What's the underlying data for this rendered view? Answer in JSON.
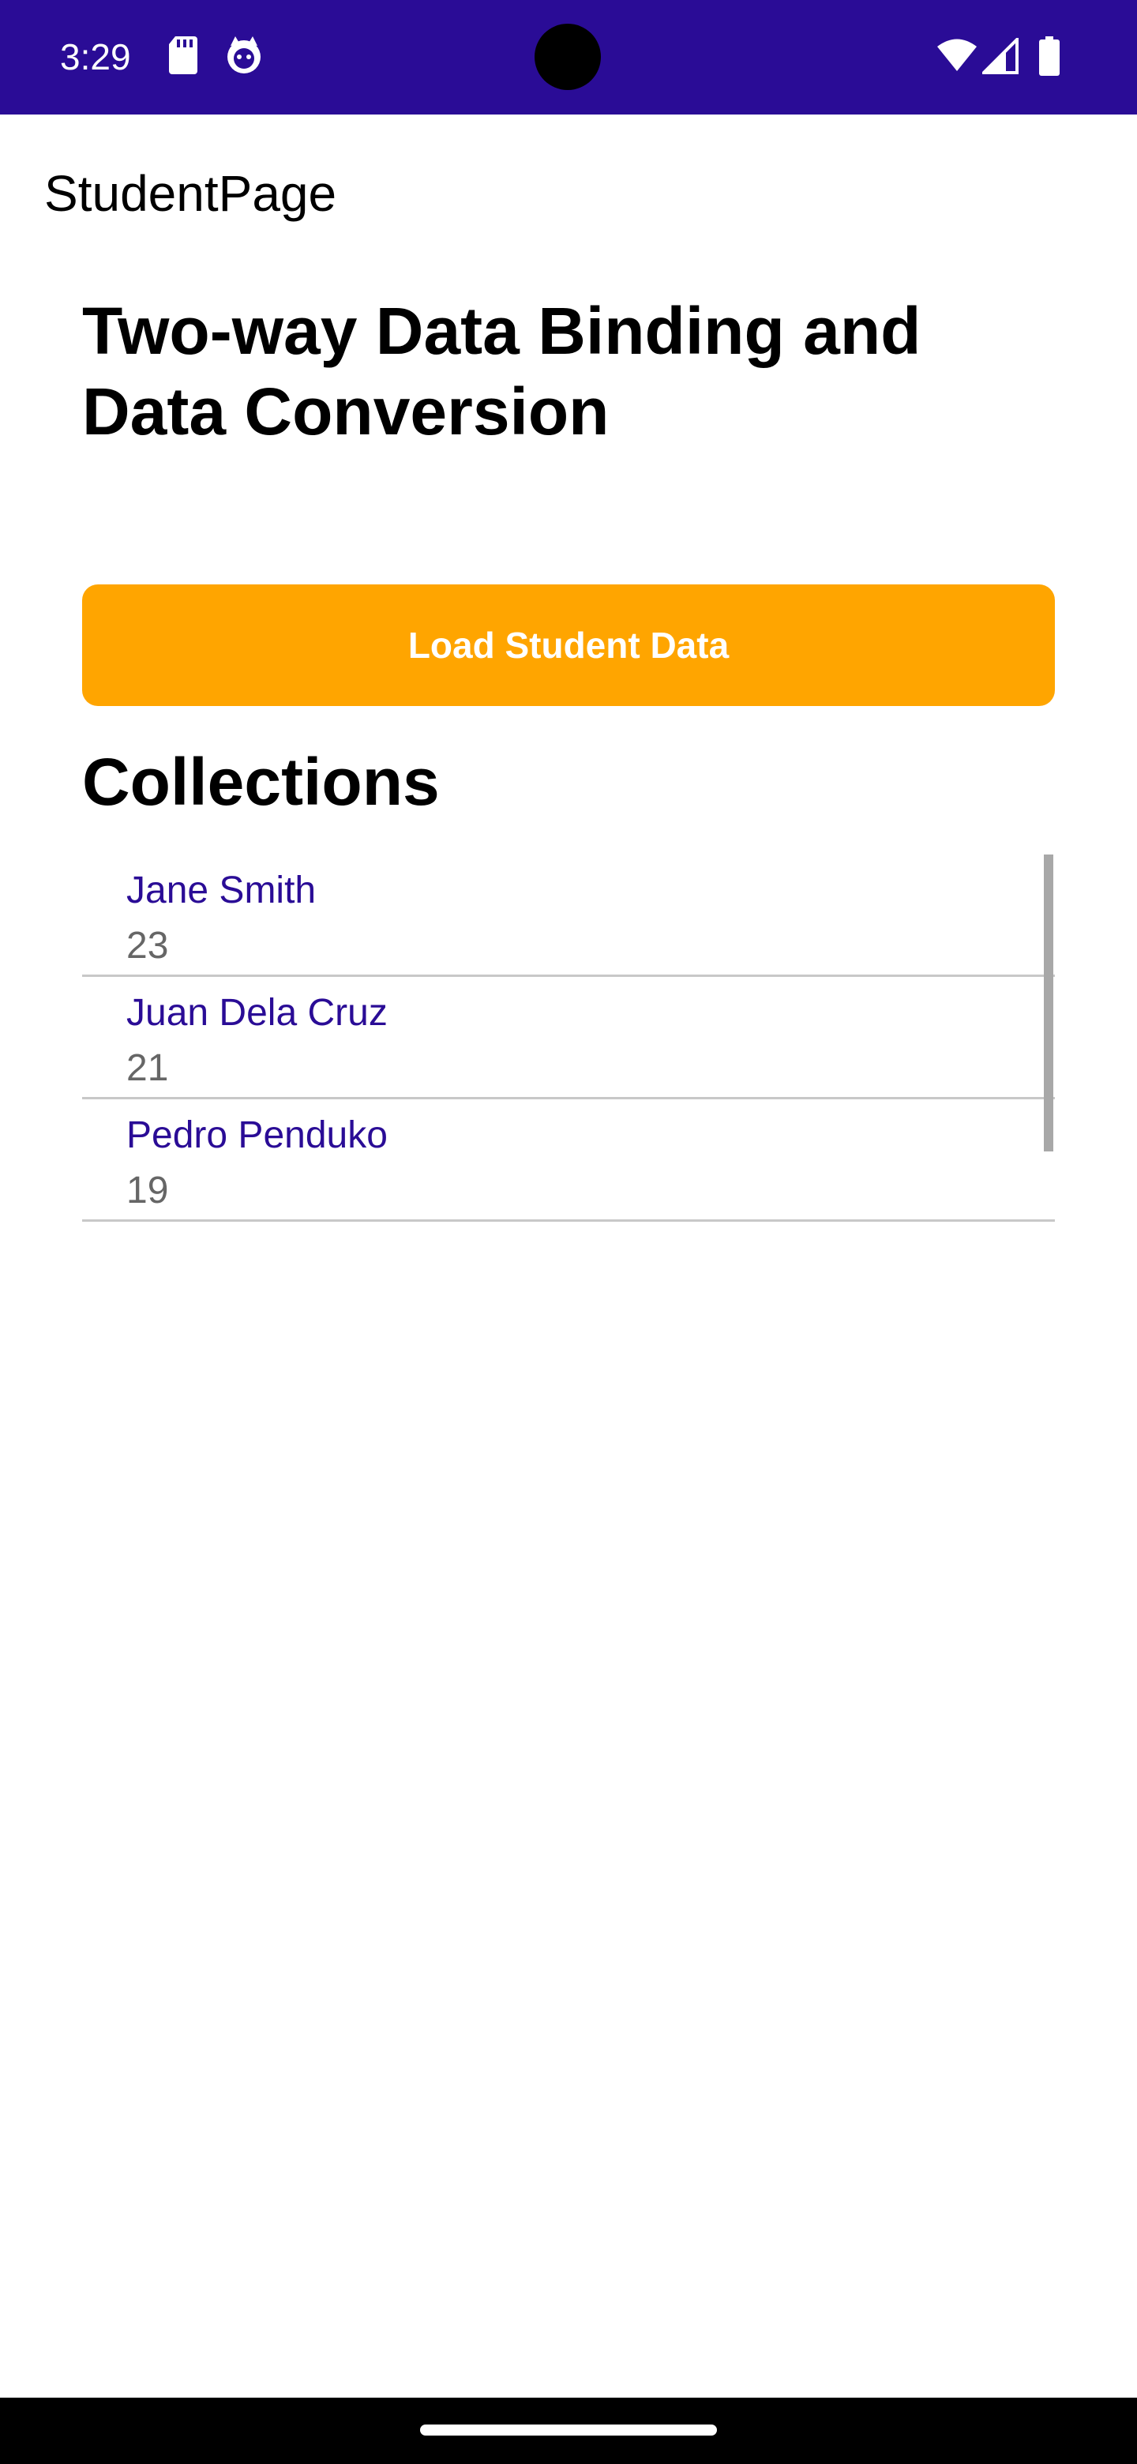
{
  "status_bar": {
    "time": "3:29",
    "bg_color": "#2a0c96",
    "icons_left": [
      "sd-card-icon",
      "notification-face-icon"
    ],
    "icons_right": [
      "wifi-icon",
      "cell-signal-icon",
      "battery-icon"
    ]
  },
  "app": {
    "title": "StudentPage"
  },
  "main": {
    "heading": "Two-way Data Binding and Data Conversion",
    "load_button_label": "Load Student Data",
    "button_color": "#ffa500",
    "collections_heading": "Collections",
    "students": [
      {
        "name": "Jane Smith",
        "age": "23"
      },
      {
        "name": "Juan Dela Cruz",
        "age": "21"
      },
      {
        "name": "Pedro Penduko",
        "age": "19"
      }
    ]
  }
}
